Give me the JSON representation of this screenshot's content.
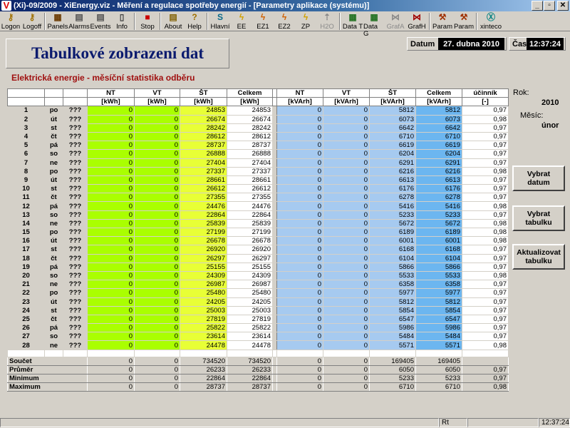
{
  "window": {
    "title": "(Xi)-09/2009 - XiEnergy.viz - Měření a regulace spotřeby energií - [Parametry aplikace (systému)]",
    "minimize": "_",
    "restore": "▫",
    "close": "✕"
  },
  "toolbar": [
    {
      "label": "Logon",
      "icon": "key-icon",
      "glyph": "⚷",
      "color": "#a07000",
      "disabled": false
    },
    {
      "label": "Logoff",
      "icon": "key-icon",
      "glyph": "⚷",
      "color": "#a07000",
      "disabled": false
    },
    {
      "sep": true
    },
    {
      "label": "Panels",
      "icon": "panels-icon",
      "glyph": "▦",
      "color": "#6b3a00",
      "disabled": false
    },
    {
      "label": "Alarms",
      "icon": "alarms-icon",
      "glyph": "▤",
      "color": "#505050",
      "disabled": false
    },
    {
      "label": "Events",
      "icon": "events-icon",
      "glyph": "▤",
      "color": "#505050",
      "disabled": false
    },
    {
      "label": "Info",
      "icon": "info-icon",
      "glyph": "▯",
      "color": "#404040",
      "disabled": false
    },
    {
      "sep": true
    },
    {
      "label": "Stop",
      "icon": "stop-icon",
      "glyph": "■",
      "color": "#cc0000",
      "disabled": false
    },
    {
      "sep": true
    },
    {
      "label": "About",
      "icon": "about-icon",
      "glyph": "▤",
      "color": "#806000",
      "disabled": false
    },
    {
      "label": "Help",
      "icon": "help-icon",
      "glyph": "?",
      "color": "#a07000",
      "disabled": false
    },
    {
      "sep": true
    },
    {
      "label": "Hlavní",
      "icon": "main-panel-icon",
      "glyph": "S",
      "color": "#0a6a8a",
      "disabled": false
    },
    {
      "label": "EE",
      "icon": "lightning-icon",
      "glyph": "ϟ",
      "color": "#d0a000",
      "disabled": false
    },
    {
      "label": "EZ1",
      "icon": "lightning-icon",
      "glyph": "ϟ",
      "color": "#d06000",
      "disabled": false
    },
    {
      "label": "EZ2",
      "icon": "lightning-icon",
      "glyph": "ϟ",
      "color": "#d06000",
      "disabled": false
    },
    {
      "label": "ZP",
      "icon": "gas-icon",
      "glyph": "ϟ",
      "color": "#d0a000",
      "disabled": false
    },
    {
      "label": "H2O",
      "icon": "water-icon",
      "glyph": "⇡",
      "color": "#8a8a8a",
      "disabled": true
    },
    {
      "sep": true
    },
    {
      "label": "Data T",
      "icon": "table-icon",
      "glyph": "▦",
      "color": "#207020",
      "disabled": false
    },
    {
      "label": "Data G",
      "icon": "graph-data-icon",
      "glyph": "▦",
      "color": "#207020",
      "disabled": false
    },
    {
      "label": "GrafA",
      "icon": "graph-icon",
      "glyph": "⋈",
      "color": "#8a8a8a",
      "disabled": true
    },
    {
      "label": "GrafH",
      "icon": "graph-icon",
      "glyph": "⋈",
      "color": "#a00000",
      "disabled": false
    },
    {
      "sep": true
    },
    {
      "label": "Param",
      "icon": "tools-icon",
      "glyph": "⚒",
      "color": "#a03000",
      "disabled": false
    },
    {
      "label": "Param",
      "icon": "tools-icon",
      "glyph": "⚒",
      "color": "#a03000",
      "disabled": false
    },
    {
      "sep": true
    },
    {
      "label": "xinteco",
      "icon": "xinteco-icon",
      "glyph": "Ⓧ",
      "color": "#008080",
      "disabled": false
    }
  ],
  "header": {
    "title": "Tabulkové zobrazení dat",
    "date_label": "Datum",
    "date_value": "27. dubna 2010",
    "time_label": "Čas",
    "time_value": "12:37:24"
  },
  "subtitle": "Elektrická energie - měsíční statistika odběru",
  "table": {
    "columns": [
      {
        "name": "NT",
        "unit": "[kWh]"
      },
      {
        "name": "VT",
        "unit": "[kWh]"
      },
      {
        "name": "ŠT",
        "unit": "[kWh]"
      },
      {
        "name": "Celkem",
        "unit": "[kWh]"
      },
      {
        "name": "NT",
        "unit": "[kVArh]"
      },
      {
        "name": "VT",
        "unit": "[kVArh]"
      },
      {
        "name": "ŠT",
        "unit": "[kVArh]"
      },
      {
        "name": "Celkem",
        "unit": "[kVArh]"
      },
      {
        "name": "účinník",
        "unit": "[-]"
      }
    ],
    "rows": [
      {
        "day": "1",
        "dow": "po",
        "q": "???",
        "v": [
          "0",
          "0",
          "24853",
          "24853",
          "0",
          "0",
          "5812",
          "5812",
          "0,97"
        ]
      },
      {
        "day": "2",
        "dow": "út",
        "q": "???",
        "v": [
          "0",
          "0",
          "26674",
          "26674",
          "0",
          "0",
          "6073",
          "6073",
          "0,98"
        ]
      },
      {
        "day": "3",
        "dow": "st",
        "q": "???",
        "v": [
          "0",
          "0",
          "28242",
          "28242",
          "0",
          "0",
          "6642",
          "6642",
          "0,97"
        ]
      },
      {
        "day": "4",
        "dow": "čt",
        "q": "???",
        "v": [
          "0",
          "0",
          "28612",
          "28612",
          "0",
          "0",
          "6710",
          "6710",
          "0,97"
        ]
      },
      {
        "day": "5",
        "dow": "pá",
        "q": "???",
        "v": [
          "0",
          "0",
          "28737",
          "28737",
          "0",
          "0",
          "6619",
          "6619",
          "0,97"
        ]
      },
      {
        "day": "6",
        "dow": "so",
        "q": "???",
        "v": [
          "0",
          "0",
          "26888",
          "26888",
          "0",
          "0",
          "6204",
          "6204",
          "0,97"
        ]
      },
      {
        "day": "7",
        "dow": "ne",
        "q": "???",
        "v": [
          "0",
          "0",
          "27404",
          "27404",
          "0",
          "0",
          "6291",
          "6291",
          "0,97"
        ]
      },
      {
        "day": "8",
        "dow": "po",
        "q": "???",
        "v": [
          "0",
          "0",
          "27337",
          "27337",
          "0",
          "0",
          "6216",
          "6216",
          "0,98"
        ]
      },
      {
        "day": "9",
        "dow": "út",
        "q": "???",
        "v": [
          "0",
          "0",
          "28661",
          "28661",
          "0",
          "0",
          "6613",
          "6613",
          "0,97"
        ]
      },
      {
        "day": "10",
        "dow": "st",
        "q": "???",
        "v": [
          "0",
          "0",
          "26612",
          "26612",
          "0",
          "0",
          "6176",
          "6176",
          "0,97"
        ]
      },
      {
        "day": "11",
        "dow": "čt",
        "q": "???",
        "v": [
          "0",
          "0",
          "27355",
          "27355",
          "0",
          "0",
          "6278",
          "6278",
          "0,97"
        ]
      },
      {
        "day": "12",
        "dow": "pá",
        "q": "???",
        "v": [
          "0",
          "0",
          "24476",
          "24476",
          "0",
          "0",
          "5416",
          "5416",
          "0,98"
        ]
      },
      {
        "day": "13",
        "dow": "so",
        "q": "???",
        "v": [
          "0",
          "0",
          "22864",
          "22864",
          "0",
          "0",
          "5233",
          "5233",
          "0,97"
        ]
      },
      {
        "day": "14",
        "dow": "ne",
        "q": "???",
        "v": [
          "0",
          "0",
          "25839",
          "25839",
          "0",
          "0",
          "5672",
          "5672",
          "0,98"
        ]
      },
      {
        "day": "15",
        "dow": "po",
        "q": "???",
        "v": [
          "0",
          "0",
          "27199",
          "27199",
          "0",
          "0",
          "6189",
          "6189",
          "0,98"
        ]
      },
      {
        "day": "16",
        "dow": "út",
        "q": "???",
        "v": [
          "0",
          "0",
          "26678",
          "26678",
          "0",
          "0",
          "6001",
          "6001",
          "0,98"
        ]
      },
      {
        "day": "17",
        "dow": "st",
        "q": "???",
        "v": [
          "0",
          "0",
          "26920",
          "26920",
          "0",
          "0",
          "6168",
          "6168",
          "0,97"
        ]
      },
      {
        "day": "18",
        "dow": "čt",
        "q": "???",
        "v": [
          "0",
          "0",
          "26297",
          "26297",
          "0",
          "0",
          "6104",
          "6104",
          "0,97"
        ]
      },
      {
        "day": "19",
        "dow": "pá",
        "q": "???",
        "v": [
          "0",
          "0",
          "25155",
          "25155",
          "0",
          "0",
          "5866",
          "5866",
          "0,97"
        ]
      },
      {
        "day": "20",
        "dow": "so",
        "q": "???",
        "v": [
          "0",
          "0",
          "24309",
          "24309",
          "0",
          "0",
          "5533",
          "5533",
          "0,98"
        ]
      },
      {
        "day": "21",
        "dow": "ne",
        "q": "???",
        "v": [
          "0",
          "0",
          "26987",
          "26987",
          "0",
          "0",
          "6358",
          "6358",
          "0,97"
        ]
      },
      {
        "day": "22",
        "dow": "po",
        "q": "???",
        "v": [
          "0",
          "0",
          "25480",
          "25480",
          "0",
          "0",
          "5977",
          "5977",
          "0,97"
        ]
      },
      {
        "day": "23",
        "dow": "út",
        "q": "???",
        "v": [
          "0",
          "0",
          "24205",
          "24205",
          "0",
          "0",
          "5812",
          "5812",
          "0,97"
        ]
      },
      {
        "day": "24",
        "dow": "st",
        "q": "???",
        "v": [
          "0",
          "0",
          "25003",
          "25003",
          "0",
          "0",
          "5854",
          "5854",
          "0,97"
        ]
      },
      {
        "day": "25",
        "dow": "čt",
        "q": "???",
        "v": [
          "0",
          "0",
          "27819",
          "27819",
          "0",
          "0",
          "6547",
          "6547",
          "0,97"
        ]
      },
      {
        "day": "26",
        "dow": "pá",
        "q": "???",
        "v": [
          "0",
          "0",
          "25822",
          "25822",
          "0",
          "0",
          "5986",
          "5986",
          "0,97"
        ]
      },
      {
        "day": "27",
        "dow": "so",
        "q": "???",
        "v": [
          "0",
          "0",
          "23614",
          "23614",
          "0",
          "0",
          "5484",
          "5484",
          "0,97"
        ]
      },
      {
        "day": "28",
        "dow": "ne",
        "q": "???",
        "v": [
          "0",
          "0",
          "24478",
          "24478",
          "0",
          "0",
          "5571",
          "5571",
          "0,98"
        ]
      }
    ],
    "summary": [
      {
        "label": "Součet",
        "v": [
          "0",
          "0",
          "734520",
          "734520",
          "0",
          "0",
          "169405",
          "169405",
          ""
        ]
      },
      {
        "label": "Průměr",
        "v": [
          "0",
          "0",
          "26233",
          "26233",
          "0",
          "0",
          "6050",
          "6050",
          "0,97"
        ]
      },
      {
        "label": "Minimum",
        "v": [
          "0",
          "0",
          "22864",
          "22864",
          "0",
          "0",
          "5233",
          "5233",
          "0,97"
        ]
      },
      {
        "label": "Maximum",
        "v": [
          "0",
          "0",
          "28737",
          "28737",
          "0",
          "0",
          "6710",
          "6710",
          "0,98"
        ]
      }
    ]
  },
  "side": {
    "year_label": "Rok:",
    "year_value": "2010",
    "month_label": "Měsíc:",
    "month_value": "únor",
    "btn_date": "Vybrat\ndatum",
    "btn_table": "Vybrat\ntabulku",
    "btn_refresh": "Aktualizovat\ntabulku"
  },
  "status": {
    "mode": "Rt",
    "time": "12:37:24"
  }
}
